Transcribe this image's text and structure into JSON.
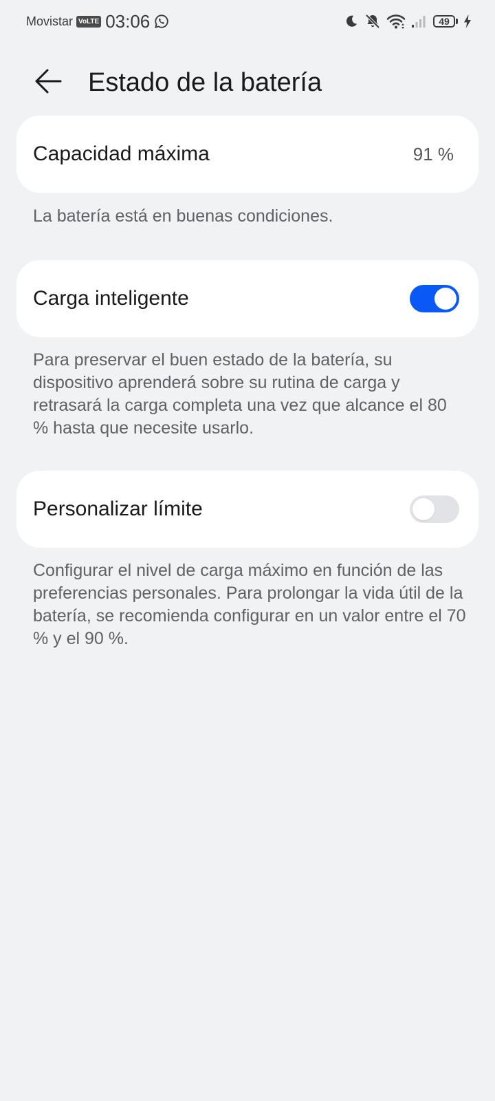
{
  "status_bar": {
    "carrier": "Movistar",
    "volte": "VoLTE",
    "time": "03:06",
    "battery_level": "49",
    "icons": [
      "whatsapp-icon",
      "moon-icon",
      "bell-off-icon",
      "wifi-icon",
      "signal-icon",
      "battery-icon",
      "charging-icon"
    ]
  },
  "header": {
    "back_icon": "arrow-left-icon",
    "title": "Estado de la batería"
  },
  "capacity": {
    "label": "Capacidad máxima",
    "value": "91 %",
    "description": "La batería está en buenas condiciones."
  },
  "smart_charge": {
    "label": "Carga inteligente",
    "enabled": true,
    "description": "Para preservar el buen estado de la batería, su dispositivo aprenderá sobre su rutina de carga y retrasará la carga completa una vez que alcance el 80 % hasta que necesite usarlo."
  },
  "custom_limit": {
    "label": "Personalizar límite",
    "enabled": false,
    "description": "Configurar el nivel de carga máximo en función de las preferencias personales. Para prolongar la vida útil de la batería, se recomienda configurar en un valor entre el 70 % y el 90 %."
  },
  "colors": {
    "background": "#f1f2f4",
    "card": "#ffffff",
    "accent": "#0a59f7",
    "toggle_off": "#e2e3e6",
    "secondary_text": "#5f6166"
  }
}
